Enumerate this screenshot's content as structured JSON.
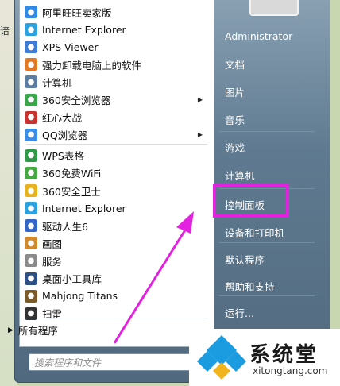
{
  "backdrop": {
    "cut_text": "谙"
  },
  "programs": [
    {
      "label": "阿里旺旺卖家版",
      "icon": "aliwangwang-icon",
      "color": "#2f8ae5",
      "has_arrow": false
    },
    {
      "label": "Internet Explorer",
      "icon": "ie-icon",
      "color": "#2aa2e0",
      "has_arrow": false
    },
    {
      "label": "XPS Viewer",
      "icon": "xps-viewer-icon",
      "color": "#3c7bd6",
      "has_arrow": false
    },
    {
      "label": "强力卸载电脑上的软件",
      "icon": "uninstall-icon",
      "color": "#e17a23",
      "has_arrow": false
    },
    {
      "label": "计算机",
      "icon": "computer-icon",
      "color": "#5d7ea3",
      "has_arrow": false
    },
    {
      "label": "360安全浏览器",
      "icon": "360-browser-icon",
      "color": "#3aa64b",
      "has_arrow": true
    },
    {
      "label": "红心大战",
      "icon": "hearts-game-icon",
      "color": "#c9332f",
      "has_arrow": false
    },
    {
      "label": "QQ浏览器",
      "icon": "qq-browser-icon",
      "color": "#3a8ee6",
      "has_arrow": true
    },
    {
      "label": "WPS表格",
      "icon": "wps-sheet-icon",
      "color": "#2e9a47",
      "has_arrow": false
    },
    {
      "label": "360免费WiFi",
      "icon": "360-wifi-icon",
      "color": "#46a843",
      "has_arrow": false
    },
    {
      "label": "360安全卫士",
      "icon": "360-safe-icon",
      "color": "#e8b21d",
      "has_arrow": false
    },
    {
      "label": "Internet Explorer",
      "icon": "ie-icon",
      "color": "#2aa2e0",
      "has_arrow": false
    },
    {
      "label": "驱动人生6",
      "icon": "driver-icon",
      "color": "#3266c8",
      "has_arrow": false
    },
    {
      "label": "画图",
      "icon": "paint-icon",
      "color": "#d08a2e",
      "has_arrow": false
    },
    {
      "label": "服务",
      "icon": "services-icon",
      "color": "#8a8a8a",
      "has_arrow": false
    },
    {
      "label": "桌面小工具库",
      "icon": "gadgets-icon",
      "color": "#2b4f86",
      "has_arrow": false
    },
    {
      "label": "Mahjong Titans",
      "icon": "mahjong-icon",
      "color": "#7a5a2a",
      "has_arrow": false
    },
    {
      "label": "扫雷",
      "icon": "minesweeper-icon",
      "color": "#333333",
      "has_arrow": false
    }
  ],
  "all_programs": "所有程序",
  "search_placeholder": "搜索程序和文件",
  "right_items": [
    {
      "label": "Administrator"
    },
    {
      "label": "文档"
    },
    {
      "label": "图片"
    },
    {
      "label": "音乐"
    },
    {
      "label": "游戏"
    },
    {
      "label": "计算机"
    },
    {
      "label": "控制面板"
    },
    {
      "label": "设备和打印机"
    },
    {
      "label": "默认程序"
    },
    {
      "label": "帮助和支持"
    },
    {
      "label": "运行..."
    }
  ],
  "logo": {
    "name": "系统堂",
    "url": "xitongtang.com"
  },
  "colors": {
    "highlight": "#e421e0",
    "menu_blue": "#5f7a90"
  }
}
